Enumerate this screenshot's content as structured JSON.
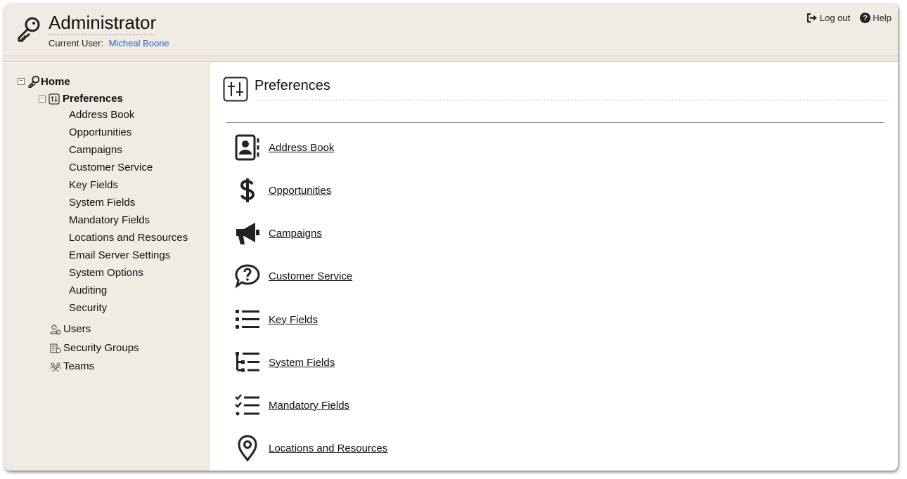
{
  "header": {
    "title": "Administrator",
    "current_user_label": "Current User:",
    "current_user_name": "Micheal Boone",
    "logout_label": "Log out",
    "help_label": "Help"
  },
  "sidebar": {
    "home_label": "Home",
    "preferences_label": "Preferences",
    "preference_items": [
      "Address Book",
      "Opportunities",
      "Campaigns",
      "Customer Service",
      "Key Fields",
      "System Fields",
      "Mandatory Fields",
      "Locations and Resources",
      "Email Server Settings",
      "System Options",
      "Auditing",
      "Security"
    ],
    "users_label": "Users",
    "security_groups_label": "Security Groups",
    "teams_label": "Teams"
  },
  "main": {
    "title": "Preferences",
    "links": [
      {
        "label": "Address Book",
        "icon": "address-book-icon"
      },
      {
        "label": "Opportunities",
        "icon": "dollar-icon"
      },
      {
        "label": "Campaigns",
        "icon": "megaphone-icon"
      },
      {
        "label": "Customer Service",
        "icon": "question-bubble-icon"
      },
      {
        "label": "Key Fields",
        "icon": "list-icon"
      },
      {
        "label": "System Fields",
        "icon": "tree-list-icon"
      },
      {
        "label": "Mandatory Fields",
        "icon": "checklist-icon"
      },
      {
        "label": "Locations and Resources",
        "icon": "location-pin-icon"
      }
    ]
  },
  "colors": {
    "header_bg": "#f0ebe3",
    "sidebar_bg": "#f0ebe3",
    "user_link": "#2a62c9"
  }
}
